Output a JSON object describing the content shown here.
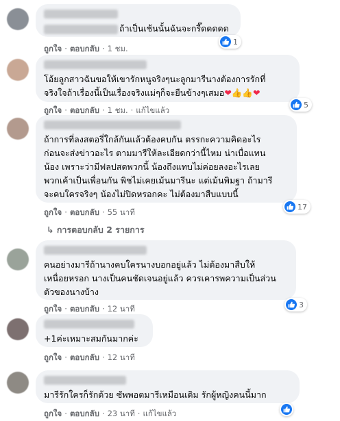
{
  "actions": {
    "like": "ถูกใจ",
    "reply": "ตอบกลับ",
    "edited": "แก้ไขแล้ว",
    "separator": "·"
  },
  "comments": [
    {
      "text": [
        "ถ้าเป็นเช้นนั้นฉันจะกรี๊ดดดดด"
      ],
      "time": "1 ชม.",
      "likes": "1",
      "edited": false,
      "avatar_color": "#8a8f96"
    },
    {
      "text": [
        "โอ้ยลูกสาวฉันขอให้เขารักหนูจริงๆนะลูกมารีนางต้องการรักที่",
        "จริงใจถ้าเรื่องนี้เป็นเรื่องจริงแม่ๆก็จะยืนข้างๆเสมอ"
      ],
      "time": "1 ชม.",
      "likes": "5",
      "edited": true,
      "avatar_color": "#c9a895"
    },
    {
      "text": [
        "ถ้าการที่ลงสตอรี่ใกล้กันแล้วต้องคบกัน ตรรกะความคิดอะไร",
        "ก่อนจะส่งข่าวอะไร ตามมารีให้ละเอียดกว่านี้ไหม น่าเบื่อแทน",
        "น้อง เพราะว่ามีฟลปสดพวกนี้ น้องถึงแทบไม่ค่อยลงอะไรเลย",
        "พวกเค้าเป็นเพื่อนกัน พิชไม่เคยเม้นมารีนะ แต่เม้นพิมฐา ถ้ามารี",
        "จะคบใครจริงๆ น้องไม่ปิดหรอกคะ ไม่ต้องมาสืบแบบนี้"
      ],
      "time": "55 นาที",
      "likes": "17",
      "edited": false,
      "replies": "การตอบกลับ 2 รายการ",
      "avatar_color": "#b39a8e"
    },
    {
      "text": [
        "คนอย่างมารีถ้านางคบใครนางบอกอยู่แล้ว ไม่ต้องมาสืบให้",
        "เหนื่อยหรอก นางเป็นคนชัดเจนอยู่แล้ว ควรเคารพความเป็นส่วน",
        "ตัวของนางบ้าง"
      ],
      "time": "12 นาที",
      "likes": "3",
      "edited": false,
      "avatar_color": "#9aa39a"
    },
    {
      "text": [
        "+1ค่ะเหมาะสมกันมากค่ะ"
      ],
      "time": "12 นาที",
      "likes": "",
      "edited": false,
      "avatar_color": "#7d7070"
    },
    {
      "text": [
        "มารีรักใครก็รักด้วย ซัพพอตมารีเหมือนเดิม รักผู้หญิงคนนี้มาก"
      ],
      "time": "23 นาที",
      "likes": "",
      "edited": true,
      "avatar_color": "#8e8a84"
    }
  ]
}
